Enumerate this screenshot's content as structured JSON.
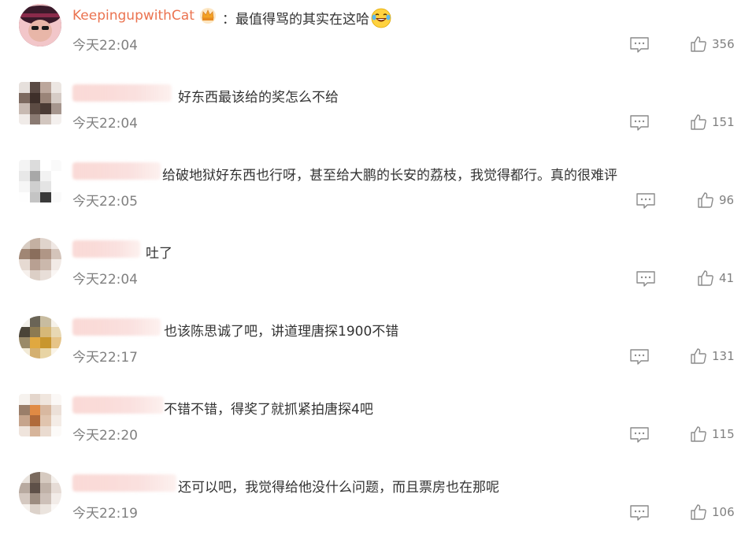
{
  "comments": [
    {
      "username": "KeepingupwithCat",
      "text": "：最值得骂的其实在这哈",
      "time": "今天22:04",
      "likes": "356"
    },
    {
      "username": "",
      "text": "好东西最该给的奖怎么不给",
      "time": "今天22:04",
      "likes": "151"
    },
    {
      "username": "",
      "text": "给破地狱好东西也行呀，甚至给大鹏的长安的荔枝，我觉得都行。真的很难评",
      "time": "今天22:05",
      "likes": "96"
    },
    {
      "username": "",
      "text": "吐了",
      "time": "今天22:04",
      "likes": "41"
    },
    {
      "username": "",
      "text": "也该陈思诚了吧，讲道理唐探1900不错",
      "time": "今天22:17",
      "likes": "131"
    },
    {
      "username": "",
      "text": "不错不错，得奖了就抓紧拍唐探4吧",
      "time": "今天22:20",
      "likes": "115"
    },
    {
      "username": "",
      "text": "还可以吧，我觉得给他没什么问题，而且票房也在那呢",
      "time": "今天22:19",
      "likes": "106"
    }
  ],
  "icons": {
    "reply": "comment-icon",
    "like": "thumbs-up-icon",
    "badge": "crown-badge-icon",
    "emoji": "laughing-tears-emoji"
  },
  "colors": {
    "username": "#eb7350",
    "text": "#333333",
    "meta": "#808080"
  }
}
